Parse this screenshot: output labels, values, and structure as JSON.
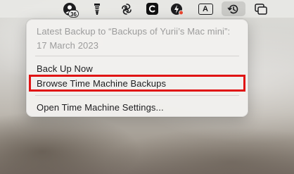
{
  "menubar": {
    "notification_badge": "36",
    "text_input_glyph": "A",
    "icons": [
      "avatar-badge-icon",
      "glass-icon",
      "swirl-icon",
      "app-c-icon",
      "lightning-icon",
      "text-input-icon",
      "time-machine-icon",
      "window-icon"
    ]
  },
  "menu": {
    "info_line1": "Latest Backup to “Backups of Yurii’s Mac mini”:",
    "info_line2": "17 March 2023",
    "back_up_now": "Back Up Now",
    "browse_backups": "Browse Time Machine Backups",
    "open_settings": "Open Time Machine Settings..."
  },
  "colors": {
    "highlight": "#e01414",
    "menu_text": "#1d1d1f",
    "disabled_text": "#9c9c9c"
  }
}
